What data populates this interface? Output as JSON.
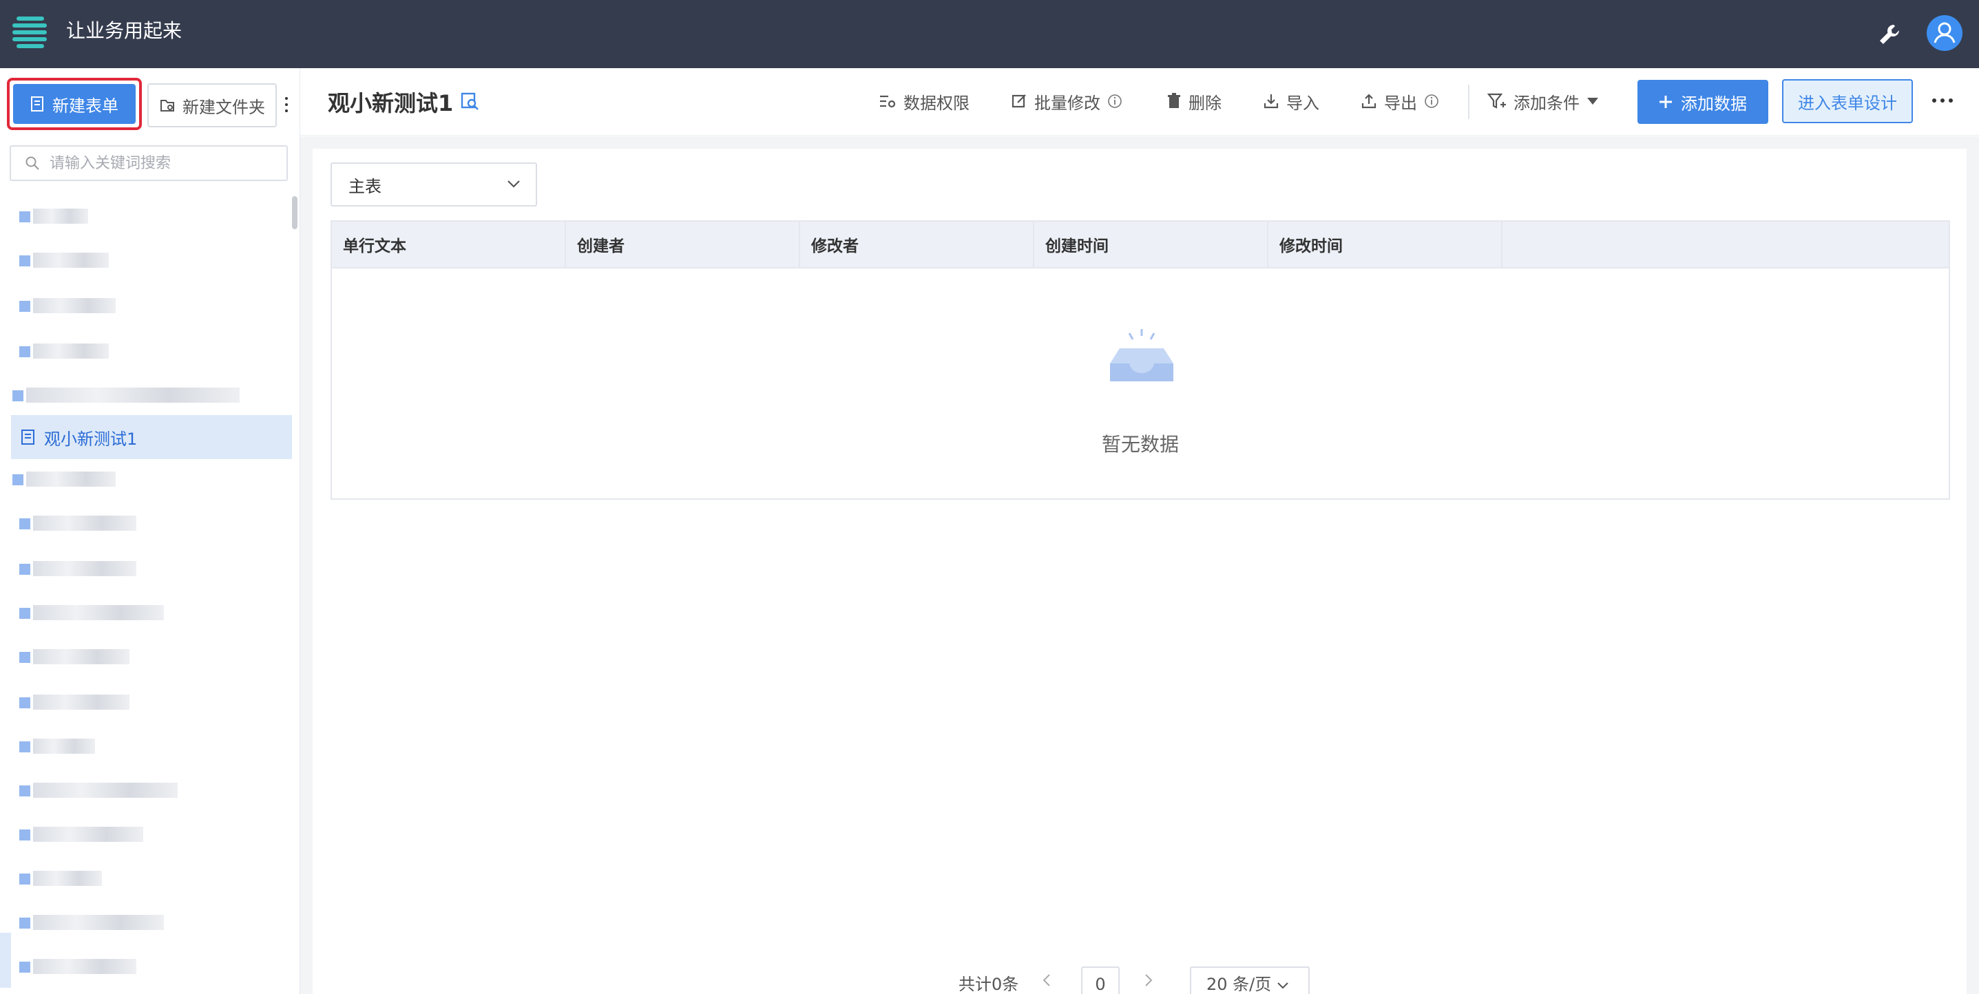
{
  "app": {
    "title": "让业务用起来"
  },
  "colors": {
    "topbar": "#353c4e",
    "accent": "#3f86e6",
    "logo": "#3ac4c0",
    "highlight": "#e0283a"
  },
  "sidebar": {
    "new_form_label": "新建表单",
    "new_folder_label": "新建文件夹",
    "search_placeholder": "请输入关键词搜索",
    "active_item_label": "观小新测试1"
  },
  "header": {
    "title": "观小新测试1",
    "tools": {
      "permissions": "数据权限",
      "batch_edit": "批量修改",
      "delete": "删除",
      "import": "导入",
      "export": "导出",
      "add_condition": "添加条件"
    },
    "add_data": "添加数据",
    "design": "进入表单设计"
  },
  "main": {
    "table_select": "主表",
    "columns": [
      "单行文本",
      "创建者",
      "修改者",
      "创建时间",
      "修改时间"
    ],
    "empty_text": "暂无数据"
  },
  "pagination": {
    "total": "共计0条",
    "page": "0",
    "page_size": "20 条/页"
  }
}
